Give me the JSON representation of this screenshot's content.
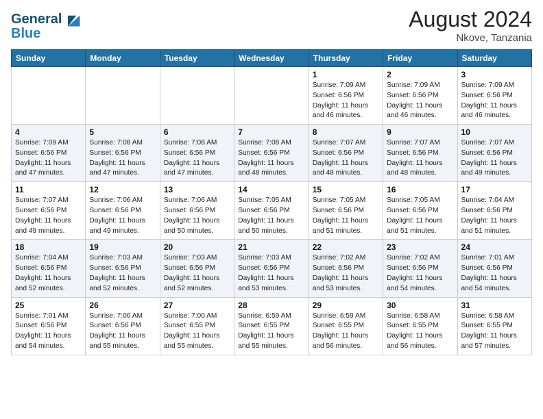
{
  "header": {
    "logo_line1": "General",
    "logo_line2": "Blue",
    "month_year": "August 2024",
    "location": "Nkove, Tanzania"
  },
  "weekdays": [
    "Sunday",
    "Monday",
    "Tuesday",
    "Wednesday",
    "Thursday",
    "Friday",
    "Saturday"
  ],
  "weeks": [
    [
      {
        "day": "",
        "info": ""
      },
      {
        "day": "",
        "info": ""
      },
      {
        "day": "",
        "info": ""
      },
      {
        "day": "",
        "info": ""
      },
      {
        "day": "1",
        "info": "Sunrise: 7:09 AM\nSunset: 6:56 PM\nDaylight: 11 hours\nand 46 minutes."
      },
      {
        "day": "2",
        "info": "Sunrise: 7:09 AM\nSunset: 6:56 PM\nDaylight: 11 hours\nand 46 minutes."
      },
      {
        "day": "3",
        "info": "Sunrise: 7:09 AM\nSunset: 6:56 PM\nDaylight: 11 hours\nand 46 minutes."
      }
    ],
    [
      {
        "day": "4",
        "info": "Sunrise: 7:09 AM\nSunset: 6:56 PM\nDaylight: 11 hours\nand 47 minutes."
      },
      {
        "day": "5",
        "info": "Sunrise: 7:08 AM\nSunset: 6:56 PM\nDaylight: 11 hours\nand 47 minutes."
      },
      {
        "day": "6",
        "info": "Sunrise: 7:08 AM\nSunset: 6:56 PM\nDaylight: 11 hours\nand 47 minutes."
      },
      {
        "day": "7",
        "info": "Sunrise: 7:08 AM\nSunset: 6:56 PM\nDaylight: 11 hours\nand 48 minutes."
      },
      {
        "day": "8",
        "info": "Sunrise: 7:07 AM\nSunset: 6:56 PM\nDaylight: 11 hours\nand 48 minutes."
      },
      {
        "day": "9",
        "info": "Sunrise: 7:07 AM\nSunset: 6:56 PM\nDaylight: 11 hours\nand 48 minutes."
      },
      {
        "day": "10",
        "info": "Sunrise: 7:07 AM\nSunset: 6:56 PM\nDaylight: 11 hours\nand 49 minutes."
      }
    ],
    [
      {
        "day": "11",
        "info": "Sunrise: 7:07 AM\nSunset: 6:56 PM\nDaylight: 11 hours\nand 49 minutes."
      },
      {
        "day": "12",
        "info": "Sunrise: 7:06 AM\nSunset: 6:56 PM\nDaylight: 11 hours\nand 49 minutes."
      },
      {
        "day": "13",
        "info": "Sunrise: 7:06 AM\nSunset: 6:56 PM\nDaylight: 11 hours\nand 50 minutes."
      },
      {
        "day": "14",
        "info": "Sunrise: 7:05 AM\nSunset: 6:56 PM\nDaylight: 11 hours\nand 50 minutes."
      },
      {
        "day": "15",
        "info": "Sunrise: 7:05 AM\nSunset: 6:56 PM\nDaylight: 11 hours\nand 51 minutes."
      },
      {
        "day": "16",
        "info": "Sunrise: 7:05 AM\nSunset: 6:56 PM\nDaylight: 11 hours\nand 51 minutes."
      },
      {
        "day": "17",
        "info": "Sunrise: 7:04 AM\nSunset: 6:56 PM\nDaylight: 11 hours\nand 51 minutes."
      }
    ],
    [
      {
        "day": "18",
        "info": "Sunrise: 7:04 AM\nSunset: 6:56 PM\nDaylight: 11 hours\nand 52 minutes."
      },
      {
        "day": "19",
        "info": "Sunrise: 7:03 AM\nSunset: 6:56 PM\nDaylight: 11 hours\nand 52 minutes."
      },
      {
        "day": "20",
        "info": "Sunrise: 7:03 AM\nSunset: 6:56 PM\nDaylight: 11 hours\nand 52 minutes."
      },
      {
        "day": "21",
        "info": "Sunrise: 7:03 AM\nSunset: 6:56 PM\nDaylight: 11 hours\nand 53 minutes."
      },
      {
        "day": "22",
        "info": "Sunrise: 7:02 AM\nSunset: 6:56 PM\nDaylight: 11 hours\nand 53 minutes."
      },
      {
        "day": "23",
        "info": "Sunrise: 7:02 AM\nSunset: 6:56 PM\nDaylight: 11 hours\nand 54 minutes."
      },
      {
        "day": "24",
        "info": "Sunrise: 7:01 AM\nSunset: 6:56 PM\nDaylight: 11 hours\nand 54 minutes."
      }
    ],
    [
      {
        "day": "25",
        "info": "Sunrise: 7:01 AM\nSunset: 6:56 PM\nDaylight: 11 hours\nand 54 minutes."
      },
      {
        "day": "26",
        "info": "Sunrise: 7:00 AM\nSunset: 6:56 PM\nDaylight: 11 hours\nand 55 minutes."
      },
      {
        "day": "27",
        "info": "Sunrise: 7:00 AM\nSunset: 6:55 PM\nDaylight: 11 hours\nand 55 minutes."
      },
      {
        "day": "28",
        "info": "Sunrise: 6:59 AM\nSunset: 6:55 PM\nDaylight: 11 hours\nand 55 minutes."
      },
      {
        "day": "29",
        "info": "Sunrise: 6:59 AM\nSunset: 6:55 PM\nDaylight: 11 hours\nand 56 minutes."
      },
      {
        "day": "30",
        "info": "Sunrise: 6:58 AM\nSunset: 6:55 PM\nDaylight: 11 hours\nand 56 minutes."
      },
      {
        "day": "31",
        "info": "Sunrise: 6:58 AM\nSunset: 6:55 PM\nDaylight: 11 hours\nand 57 minutes."
      }
    ]
  ]
}
